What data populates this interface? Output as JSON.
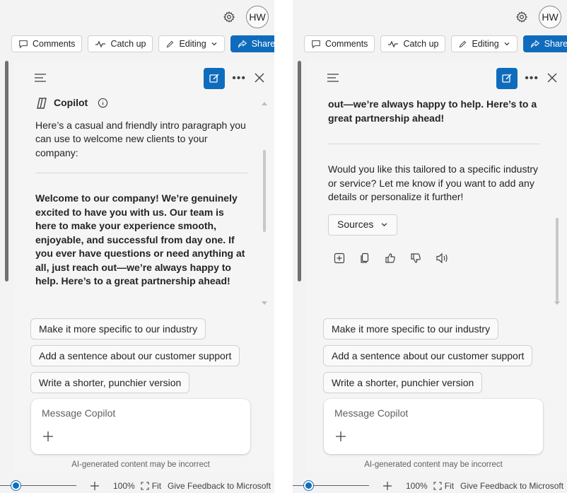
{
  "header": {
    "avatar_initials": "HW"
  },
  "toolbar": {
    "comments_label": "Comments",
    "catchup_label": "Catch up",
    "editing_label": "Editing",
    "share_label": "Share"
  },
  "copilot": {
    "title": "Copilot",
    "intro": "Here’s a casual and friendly intro paragraph you can use to welcome new clients to your company:",
    "welcome_text": "Welcome to our company! We’re genuinely excited to have you with us. Our team is here to make your experience smooth, enjoyable, and successful from day one. If you ever have questions or need anything at all, just reach out—we’re always happy to help. Here’s to a great partnership ahead!",
    "welcome_tail": "out—we’re always happy to help. Here’s to a great partnership ahead!",
    "followup": "Would you like this tailored to a specific industry or service? Let me know if you want to add any details or personalize it further!",
    "sources_label": "Sources"
  },
  "suggestions": [
    {
      "label": "Make it more specific to our industry"
    },
    {
      "label": "Add a sentence about our customer support"
    },
    {
      "label": "Write a shorter, punchier version"
    }
  ],
  "composer": {
    "placeholder": "Message Copilot"
  },
  "disclaimer": "AI-generated content may be incorrect",
  "footer": {
    "zoom": "100%",
    "fit_label": "Fit",
    "feedback_label": "Give Feedback to Microsoft",
    "zoom_slider_level": 0.17
  },
  "colors": {
    "accent": "#0f6cbd"
  }
}
